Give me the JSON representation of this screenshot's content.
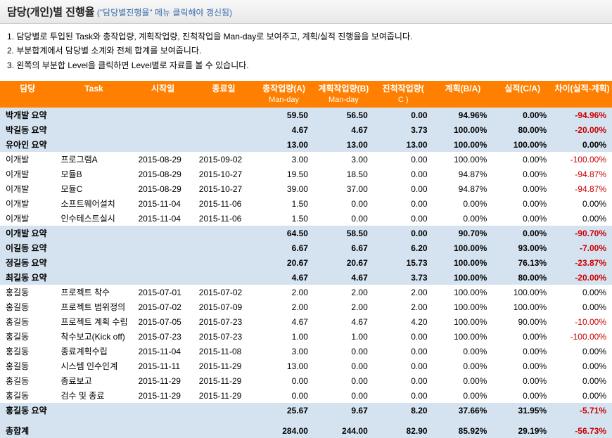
{
  "header": {
    "title": "담당(개인)별 진행율",
    "subtitle": "(\"담당별진행율\" 메뉴 클릭해야 갱신됨)"
  },
  "notes": [
    "1. 담당별로 투입된 Task와 총작업량, 계획작업량, 진척작업을 Man-day로 보여주고, 계획/실적 진행율을 보여줍니다.",
    "2. 부분합계에서 담당별 소계와 전체 합계를 보여줍니다.",
    "3. 왼쪽의 부분합 Level을 클릭하면 Level별로 자료를 볼 수 있습니다."
  ],
  "columns": [
    {
      "label": "담당",
      "sub": ""
    },
    {
      "label": "Task",
      "sub": ""
    },
    {
      "label": "시작일",
      "sub": ""
    },
    {
      "label": "종료일",
      "sub": ""
    },
    {
      "label": "총작업량(A)",
      "sub": "Man-day"
    },
    {
      "label": "계획작업량(B)",
      "sub": "Man-day"
    },
    {
      "label": "진척작업량(",
      "sub": "C )"
    },
    {
      "label": "계획(B/A)",
      "sub": ""
    },
    {
      "label": "실적(C/A)",
      "sub": ""
    },
    {
      "label": "차이(실적-계획)",
      "sub": ""
    }
  ],
  "rows": [
    {
      "type": "summary",
      "name": "박개발 요약",
      "task": "",
      "start": "",
      "end": "",
      "a": "59.50",
      "b": "56.50",
      "c": "0.00",
      "plan": "94.96%",
      "actual": "0.00%",
      "diff": "-94.96%",
      "neg": true
    },
    {
      "type": "summary",
      "name": "박길동 요약",
      "task": "",
      "start": "",
      "end": "",
      "a": "4.67",
      "b": "4.67",
      "c": "3.73",
      "plan": "100.00%",
      "actual": "80.00%",
      "diff": "-20.00%",
      "neg": true
    },
    {
      "type": "summary",
      "name": "유아인 요약",
      "task": "",
      "start": "",
      "end": "",
      "a": "13.00",
      "b": "13.00",
      "c": "13.00",
      "plan": "100.00%",
      "actual": "100.00%",
      "diff": "0.00%",
      "neg": false
    },
    {
      "type": "data",
      "name": "이개발",
      "task": "프로그램A",
      "start": "2015-08-29",
      "end": "2015-09-02",
      "a": "3.00",
      "b": "3.00",
      "c": "0.00",
      "plan": "100.00%",
      "actual": "0.00%",
      "diff": "-100.00%",
      "neg": true
    },
    {
      "type": "data",
      "name": "이개발",
      "task": "모듈B",
      "start": "2015-08-29",
      "end": "2015-10-27",
      "a": "19.50",
      "b": "18.50",
      "c": "0.00",
      "plan": "94.87%",
      "actual": "0.00%",
      "diff": "-94.87%",
      "neg": true
    },
    {
      "type": "data",
      "name": "이개발",
      "task": "모듈C",
      "start": "2015-08-29",
      "end": "2015-10-27",
      "a": "39.00",
      "b": "37.00",
      "c": "0.00",
      "plan": "94.87%",
      "actual": "0.00%",
      "diff": "-94.87%",
      "neg": true
    },
    {
      "type": "data",
      "name": "이개발",
      "task": "소프트웨어설치",
      "start": "2015-11-04",
      "end": "2015-11-06",
      "a": "1.50",
      "b": "0.00",
      "c": "0.00",
      "plan": "0.00%",
      "actual": "0.00%",
      "diff": "0.00%",
      "neg": false
    },
    {
      "type": "data",
      "name": "이개발",
      "task": "인수테스트실시",
      "start": "2015-11-04",
      "end": "2015-11-06",
      "a": "1.50",
      "b": "0.00",
      "c": "0.00",
      "plan": "0.00%",
      "actual": "0.00%",
      "diff": "0.00%",
      "neg": false
    },
    {
      "type": "summary",
      "name": "이개발 요약",
      "task": "",
      "start": "",
      "end": "",
      "a": "64.50",
      "b": "58.50",
      "c": "0.00",
      "plan": "90.70%",
      "actual": "0.00%",
      "diff": "-90.70%",
      "neg": true
    },
    {
      "type": "summary",
      "name": "이길동 요약",
      "task": "",
      "start": "",
      "end": "",
      "a": "6.67",
      "b": "6.67",
      "c": "6.20",
      "plan": "100.00%",
      "actual": "93.00%",
      "diff": "-7.00%",
      "neg": true
    },
    {
      "type": "summary",
      "name": "정길동 요약",
      "task": "",
      "start": "",
      "end": "",
      "a": "20.67",
      "b": "20.67",
      "c": "15.73",
      "plan": "100.00%",
      "actual": "76.13%",
      "diff": "-23.87%",
      "neg": true
    },
    {
      "type": "summary",
      "name": "최길동 요약",
      "task": "",
      "start": "",
      "end": "",
      "a": "4.67",
      "b": "4.67",
      "c": "3.73",
      "plan": "100.00%",
      "actual": "80.00%",
      "diff": "-20.00%",
      "neg": true
    },
    {
      "type": "data",
      "name": "홍길동",
      "task": "프로젝트 착수",
      "start": "2015-07-01",
      "end": "2015-07-02",
      "a": "2.00",
      "b": "2.00",
      "c": "2.00",
      "plan": "100.00%",
      "actual": "100.00%",
      "diff": "0.00%",
      "neg": false
    },
    {
      "type": "data",
      "name": "홍길동",
      "task": "프로젝트 범위정의",
      "start": "2015-07-02",
      "end": "2015-07-09",
      "a": "2.00",
      "b": "2.00",
      "c": "2.00",
      "plan": "100.00%",
      "actual": "100.00%",
      "diff": "0.00%",
      "neg": false
    },
    {
      "type": "data",
      "name": "홍길동",
      "task": "프로젝트 계획 수립",
      "start": "2015-07-05",
      "end": "2015-07-23",
      "a": "4.67",
      "b": "4.67",
      "c": "4.20",
      "plan": "100.00%",
      "actual": "90.00%",
      "diff": "-10.00%",
      "neg": true
    },
    {
      "type": "data",
      "name": "홍길동",
      "task": "착수보고(Kick off)",
      "start": "2015-07-23",
      "end": "2015-07-23",
      "a": "1.00",
      "b": "1.00",
      "c": "0.00",
      "plan": "100.00%",
      "actual": "0.00%",
      "diff": "-100.00%",
      "neg": true
    },
    {
      "type": "data",
      "name": "홍길동",
      "task": "종료계획수립",
      "start": "2015-11-04",
      "end": "2015-11-08",
      "a": "3.00",
      "b": "0.00",
      "c": "0.00",
      "plan": "0.00%",
      "actual": "0.00%",
      "diff": "0.00%",
      "neg": false
    },
    {
      "type": "data",
      "name": "홍길동",
      "task": "시스템 인수인계",
      "start": "2015-11-11",
      "end": "2015-11-29",
      "a": "13.00",
      "b": "0.00",
      "c": "0.00",
      "plan": "0.00%",
      "actual": "0.00%",
      "diff": "0.00%",
      "neg": false
    },
    {
      "type": "data",
      "name": "홍길동",
      "task": "종료보고",
      "start": "2015-11-29",
      "end": "2015-11-29",
      "a": "0.00",
      "b": "0.00",
      "c": "0.00",
      "plan": "0.00%",
      "actual": "0.00%",
      "diff": "0.00%",
      "neg": false
    },
    {
      "type": "data",
      "name": "홍길동",
      "task": "검수 및 종료",
      "start": "2015-11-29",
      "end": "2015-11-29",
      "a": "0.00",
      "b": "0.00",
      "c": "0.00",
      "plan": "0.00%",
      "actual": "0.00%",
      "diff": "0.00%",
      "neg": false
    },
    {
      "type": "summary",
      "name": "홍길동 요약",
      "task": "",
      "start": "",
      "end": "",
      "a": "25.67",
      "b": "9.67",
      "c": "8.20",
      "plan": "37.66%",
      "actual": "31.95%",
      "diff": "-5.71%",
      "neg": true
    },
    {
      "type": "spacer"
    },
    {
      "type": "total",
      "name": "총합계",
      "task": "",
      "start": "",
      "end": "",
      "a": "284.00",
      "b": "244.00",
      "c": "82.90",
      "plan": "85.92%",
      "actual": "29.19%",
      "diff": "-56.73%",
      "neg": true
    }
  ]
}
